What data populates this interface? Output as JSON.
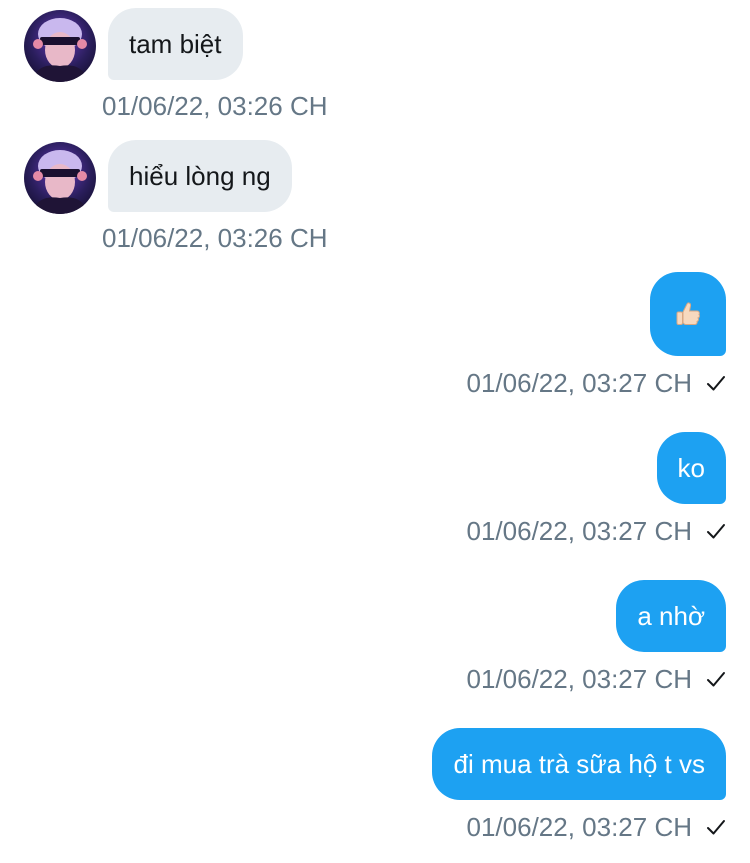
{
  "conversation": {
    "messages": [
      {
        "direction": "in",
        "text": "tam biệt",
        "timestamp": "01/06/22, 03:26 CH",
        "avatar": "user-avatar"
      },
      {
        "direction": "in",
        "text": "hiểu lòng ng",
        "timestamp": "01/06/22, 03:26 CH",
        "avatar": "user-avatar"
      },
      {
        "direction": "out",
        "text": "👍🏻",
        "timestamp": "01/06/22, 03:27 CH",
        "status_icon": "check-icon"
      },
      {
        "direction": "out",
        "text": "ko",
        "timestamp": "01/06/22, 03:27 CH",
        "status_icon": "check-icon"
      },
      {
        "direction": "out",
        "text": "a nhờ",
        "timestamp": "01/06/22, 03:27 CH",
        "status_icon": "check-icon"
      },
      {
        "direction": "out",
        "text": "đi mua trà sữa hộ t vs",
        "timestamp": "01/06/22, 03:27 CH",
        "status_icon": "check-icon"
      }
    ]
  },
  "colors": {
    "incoming_bubble": "#e7ecf0",
    "outgoing_bubble": "#1da1f2",
    "timestamp_text": "#657786",
    "incoming_text": "#14171a",
    "outgoing_text": "#ffffff"
  }
}
